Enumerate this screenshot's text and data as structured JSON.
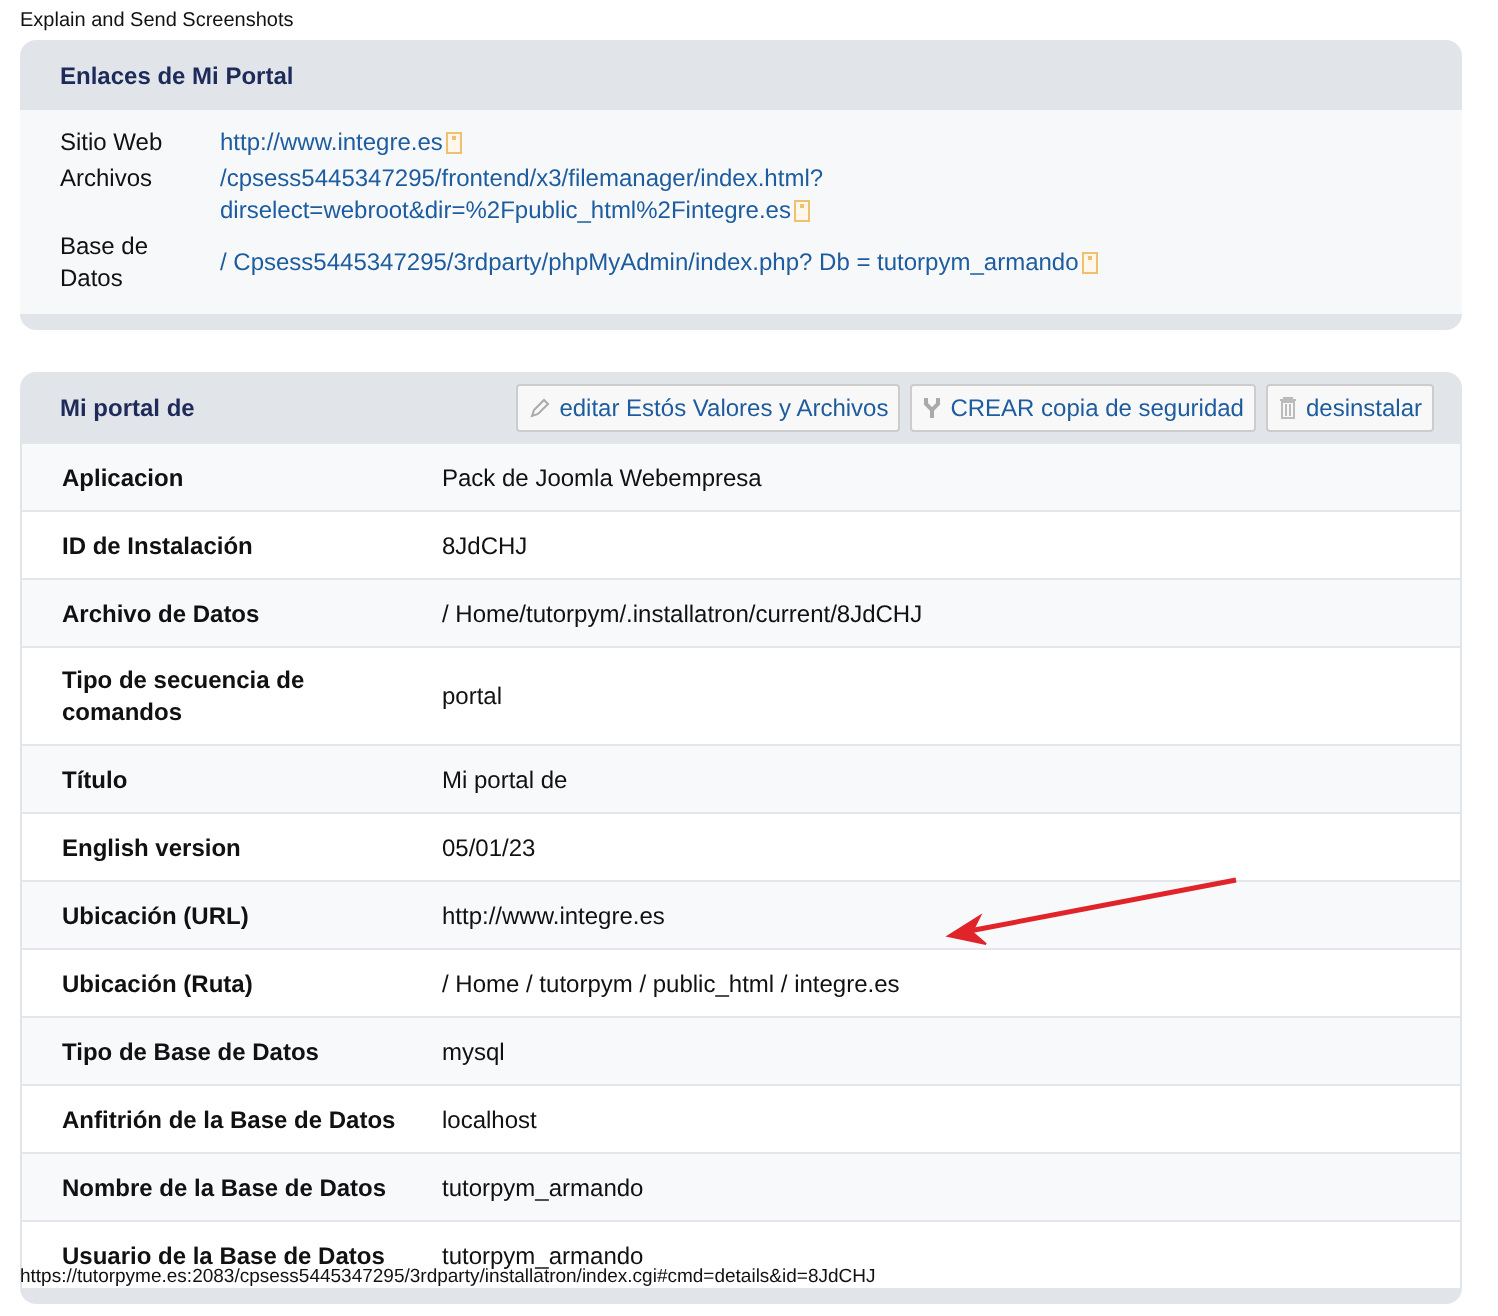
{
  "page_title": "Explain and Send Screenshots",
  "links_panel": {
    "title": "Enlaces de Mi Portal",
    "rows": [
      {
        "label": "Sitio Web",
        "lines": [
          "http://www.integre.es"
        ]
      },
      {
        "label": "Archivos",
        "lines": [
          "/cpsess5445347295/frontend/x3/filemanager/index.html?",
          "dirselect=webroot&dir=%2Fpublic_html%2Fintegre.es"
        ]
      },
      {
        "label": "Base de Datos",
        "lines": [
          "/ Cpsess5445347295/3rdparty/phpMyAdmin/index.php? Db = tutorpym_armando"
        ]
      }
    ]
  },
  "details_panel": {
    "title": "Mi portal de",
    "buttons": [
      {
        "label": "editar Estós Valores y Archivos",
        "kind": "edit"
      },
      {
        "label": "CREAR copia de seguridad",
        "kind": "backup"
      },
      {
        "label": "desinstalar",
        "kind": "delete"
      }
    ],
    "rows": [
      {
        "label": "Aplicacion",
        "value": "Pack de Joomla Webempresa"
      },
      {
        "label": "ID de Instalación",
        "value": "8JdCHJ"
      },
      {
        "label": "Archivo de Datos",
        "value": "/ Home/tutorpym/.installatron/current/8JdCHJ"
      },
      {
        "label": "Tipo de secuencia de comandos",
        "value": "portal"
      },
      {
        "label": "Título",
        "value": "Mi portal de"
      },
      {
        "label": "English version",
        "value": "05/01/23"
      },
      {
        "label": "Ubicación (URL)",
        "value": "http://www.integre.es"
      },
      {
        "label": "Ubicación (Ruta)",
        "value": "/ Home / tutorpym / public_html / integre.es"
      },
      {
        "label": "Tipo de Base de Datos",
        "value": "mysql"
      },
      {
        "label": "Anfitrión de la Base de Datos",
        "value": "localhost"
      },
      {
        "label": "Nombre de la Base de Datos",
        "value": "tutorpym_armando"
      },
      {
        "label": "Usuario de la Base de Datos",
        "value": "tutorpym_armando"
      }
    ]
  },
  "status_url": "https://tutorpyme.es:2083/cpsess5445347295/3rdparty/installatron/index.cgi#cmd=details&id=8JdCHJ"
}
